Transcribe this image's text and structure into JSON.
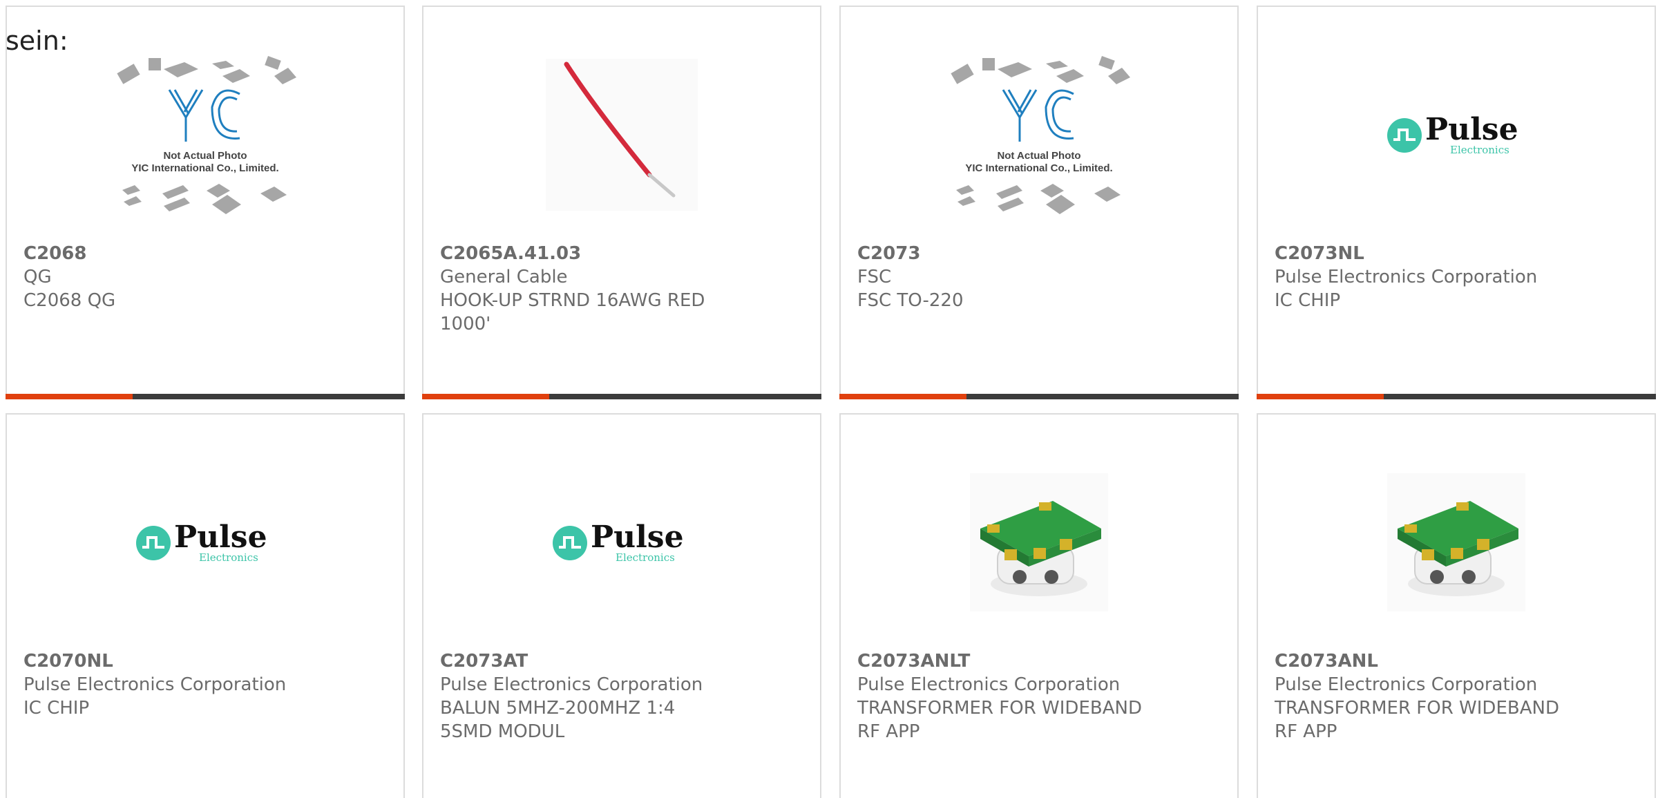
{
  "intro_text": "sein:",
  "products": [
    {
      "part": "C2068",
      "manufacturer": "QG",
      "description": "C2068 QG",
      "image": "yic-not-actual-photo",
      "image_text_1": "Not Actual Photo",
      "image_text_2": "YIC International Co., Limited."
    },
    {
      "part": "C2065A.41.03",
      "manufacturer": "General Cable",
      "description": "HOOK-UP STRND 16AWG RED 1000'",
      "image": "red-wire"
    },
    {
      "part": "C2073",
      "manufacturer": "FSC",
      "description": "FSC TO-220",
      "image": "yic-not-actual-photo",
      "image_text_1": "Not Actual Photo",
      "image_text_2": "YIC International Co., Limited."
    },
    {
      "part": "C2073NL",
      "manufacturer": "Pulse Electronics Corporation",
      "description": "IC CHIP",
      "image": "pulse-logo"
    },
    {
      "part": "C2070NL",
      "manufacturer": "Pulse Electronics Corporation",
      "description": "IC CHIP",
      "image": "pulse-logo"
    },
    {
      "part": "C2073AT",
      "manufacturer": "Pulse Electronics Corporation",
      "description": "BALUN 5MHZ-200MHZ 1:4 5SMD MODUL",
      "image": "pulse-logo"
    },
    {
      "part": "C2073ANLT",
      "manufacturer": "Pulse Electronics Corporation",
      "description": "TRANSFORMER FOR WIDEBAND RF APP",
      "image": "smd-transformer"
    },
    {
      "part": "C2073ANL",
      "manufacturer": "Pulse Electronics Corporation",
      "description": "TRANSFORMER FOR WIDEBAND RF APP",
      "image": "smd-transformer"
    }
  ],
  "colors": {
    "accent_bar": "#e0400e",
    "dark_bar": "#3c3c3c",
    "pulse_teal": "#3cc4a8",
    "yic_blue": "#1f7fbf"
  }
}
